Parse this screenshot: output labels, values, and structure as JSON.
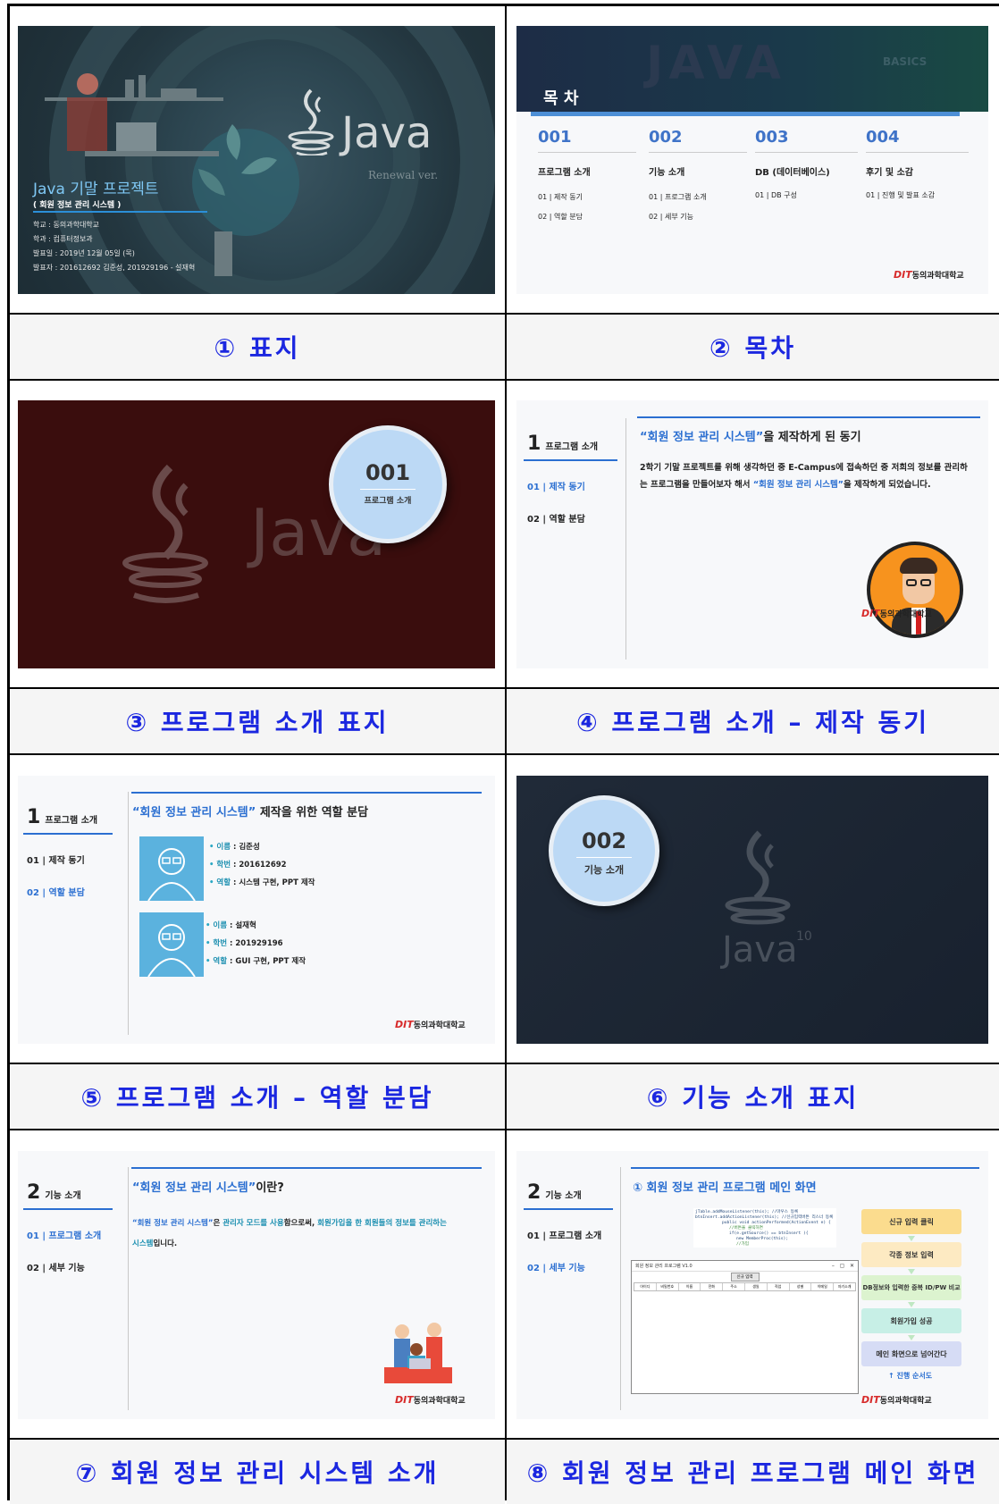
{
  "captions": [
    "① 표지",
    "② 목차",
    "③ 프로그램 소개 표지",
    "④ 프로그램 소개 – 제작 동기",
    "⑤ 프로그램 소개 – 역할 분담",
    "⑥ 기능 소개 표지",
    "⑦ 회원 정보 관리 시스템 소개",
    "⑧ 회원 정보 관리 프로그램 메인 화면"
  ],
  "slide1": {
    "java_logo": "Java",
    "renewal": "Renewal ver.",
    "title": "Java 기말 프로젝트",
    "subtitle": "( 회원 정보 관리 시스템 )",
    "school": "학교 : 동의과학대학교",
    "dept": "학과 : 컴퓨터정보과",
    "date": "발표일 : 2019년 12월 05일 (목)",
    "presenters": "발표자 : 201612692 김준성, 201929196 - 설재혁"
  },
  "slide2": {
    "banner": "JAVA",
    "banner_side": "BASICS",
    "title": "목 차",
    "sections": [
      {
        "num": "001",
        "title": "프로그램 소개",
        "items": [
          "01 | 제작 동기",
          "02 | 역할 분담"
        ]
      },
      {
        "num": "002",
        "title": "기능 소개",
        "items": [
          "01 | 프로그램 소개",
          "02 | 세부 기능"
        ]
      },
      {
        "num": "003",
        "title": "DB (데이터베이스)",
        "items": [
          "01 | DB 구성"
        ]
      },
      {
        "num": "004",
        "title": "후기 및 소감",
        "items": [
          "01 | 진행 및 발표 소감"
        ]
      }
    ],
    "logo": "동의과학대학교",
    "logo_mark": "DIT"
  },
  "slide3": {
    "num": "001",
    "label": "프로그램 소개",
    "java": "Java"
  },
  "slide4": {
    "sb_num": "1",
    "sb_label": "프로그램 소개",
    "items": [
      "01 | 제작 동기",
      "02 | 역할 분담"
    ],
    "heading_q": "“회원 정보 관리 시스템”",
    "heading_rest": "을 제작하게 된 동기",
    "body_1": "2학기 기말 프로젝트를 위해 생각하던 중 E-Campus에 접속하던 중 저희의 정보를 관리하는 프로그램을 만들어보자 해서 ",
    "body_hl": "“회원 정보 관리 시스템”",
    "body_2": "을 제작하게 되었습니다.",
    "logo": "동의과학대학교",
    "logo_mark": "DIT"
  },
  "slide5": {
    "sb_num": "1",
    "sb_label": "프로그램 소개",
    "items": [
      "01 | 제작 동기",
      "02 | 역할 분담"
    ],
    "heading_q": "“회원 정보 관리 시스템”",
    "heading_rest": " 제작을 위한 역할 분담",
    "people": [
      {
        "name_k": "이름",
        "name": " : 김준성",
        "id_k": "학번",
        "id": " : 201612692",
        "role_k": "역할",
        "role": " : 시스템 구현, PPT 제작"
      },
      {
        "name_k": "이름",
        "name": " : 설재혁",
        "id_k": "학번",
        "id": " : 201929196",
        "role_k": "역할",
        "role": " : GUI 구현, PPT 제작"
      }
    ],
    "logo": "동의과학대학교",
    "logo_mark": "DIT"
  },
  "slide6": {
    "num": "002",
    "label": "기능 소개",
    "java": "Java",
    "ver": "10"
  },
  "slide7": {
    "sb_num": "2",
    "sb_label": "기능 소개",
    "items": [
      "01 | 프로그램 소개",
      "02 | 세부 기능"
    ],
    "heading_q": "“회원 정보 관리 시스템”",
    "heading_rest": "이란?",
    "b1": "“회원 정보 관리 시스템”",
    "b2": "은 ",
    "b3": "관리자 모드를 사용",
    "b4": "함으로써, ",
    "b5": "회원가입을 한 회원들의 정보를 관리하는 시스템",
    "b6": "입니다.",
    "logo": "동의과학대학교",
    "logo_mark": "DIT"
  },
  "slide8": {
    "sb_num": "2",
    "sb_label": "기능 소개",
    "items": [
      "01 | 프로그램 소개",
      "02 | 세부 기능"
    ],
    "heading": "① 회원 정보 관리 프로그램 메인 화면",
    "code": [
      "jTable.addMouseListener(this); //마우스 등록",
      "btnInsert.addActionListener(this); //신규입력버튼 리스너 등록",
      "public void actionPerformed(ActionEvent e) {",
      "  //버튼을 클릭하면",
      "  if(e.getSource() == btnInsert ){",
      "    new MemberProc(this);",
      "    //가입"
    ],
    "window_title": "회원 정보 관리 프로그램 V1.0",
    "window_btn": "신규 입력",
    "columns": [
      "아이디",
      "비밀번호",
      "이름",
      "전화",
      "주소",
      "생일",
      "직업",
      "성별",
      "이메일",
      "자기소개"
    ],
    "flow": [
      "신규 입력 클릭",
      "각종 정보 입력",
      "DB정보와 입력한 중복 ID/PW 비교",
      "회원가입 성공",
      "메인 화면으로 넘어간다"
    ],
    "flow_caption": "↑ 진행 순서도",
    "logo": "동의과학대학교",
    "logo_mark": "DIT"
  }
}
